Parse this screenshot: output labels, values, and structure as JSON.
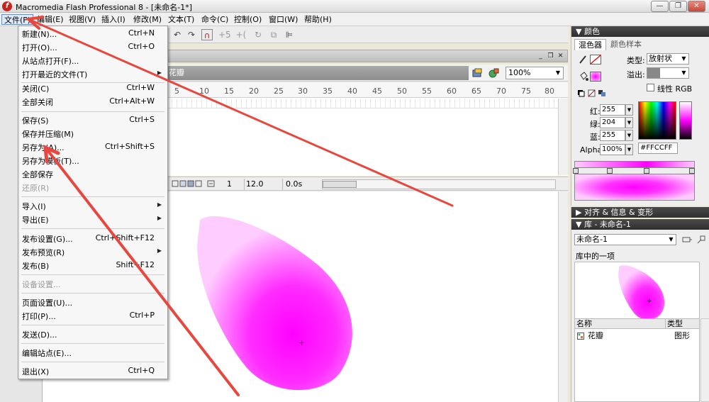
{
  "window": {
    "title": "Macromedia Flash Professional 8 - [未命名-1*]",
    "app_icon_glyph": "f",
    "minimize_glyph": "—",
    "restore_glyph": "❐",
    "close_glyph": "✕"
  },
  "menubar": {
    "items": [
      "文件(F)",
      "编辑(E)",
      "视图(V)",
      "插入(I)",
      "修改(M)",
      "文本(T)",
      "命令(C)",
      "控制(O)",
      "窗口(W)",
      "帮助(H)"
    ]
  },
  "file_menu": {
    "items": [
      {
        "label": "新建(N)...",
        "shortcut": "Ctrl+N"
      },
      {
        "label": "打开(O)...",
        "shortcut": "Ctrl+O"
      },
      {
        "label": "从站点打开(F)...",
        "shortcut": ""
      },
      {
        "label": "打开最近的文件(T)",
        "shortcut": "",
        "submenu": true
      },
      {
        "label": "关闭(C)",
        "shortcut": "Ctrl+W"
      },
      {
        "label": "全部关闭",
        "shortcut": "Ctrl+Alt+W"
      },
      {
        "label": "保存(S)",
        "shortcut": "Ctrl+S"
      },
      {
        "label": "保存并压缩(M)",
        "shortcut": ""
      },
      {
        "label": "另存为(A)...",
        "shortcut": "Ctrl+Shift+S"
      },
      {
        "label": "另存为模板(T)...",
        "shortcut": ""
      },
      {
        "label": "全部保存",
        "shortcut": ""
      },
      {
        "label": "还原(R)",
        "shortcut": "",
        "disabled": true
      },
      {
        "label": "导入(I)",
        "shortcut": "",
        "submenu": true
      },
      {
        "label": "导出(E)",
        "shortcut": "",
        "submenu": true
      },
      {
        "label": "发布设置(G)...",
        "shortcut": "Ctrl+Shift+F12"
      },
      {
        "label": "发布预览(R)",
        "shortcut": "",
        "submenu": true
      },
      {
        "label": "发布(B)",
        "shortcut": "Shift+F12"
      },
      {
        "label": "设备设置...",
        "shortcut": "",
        "disabled": true
      },
      {
        "label": "页面设置(U)...",
        "shortcut": ""
      },
      {
        "label": "打印(P)...",
        "shortcut": "Ctrl+P"
      },
      {
        "label": "发送(D)...",
        "shortcut": ""
      },
      {
        "label": "编辑站点(E)...",
        "shortcut": ""
      },
      {
        "label": "退出(X)",
        "shortcut": "Ctrl+Q"
      }
    ],
    "submenu_glyph": "▶"
  },
  "toolbar": {
    "undo_glyph": "↶",
    "redo_glyph": "↷",
    "snap_glyph": "∩",
    "smooth_glyph": "+5",
    "straighten_glyph": "+(",
    "rotate_glyph": "↻",
    "scale_glyph": "⧉",
    "align_glyph": "⊫"
  },
  "document": {
    "minimize_glyph": "_",
    "restore_glyph": "❐",
    "close_glyph": "✕",
    "scene_name": "花瓣",
    "zoom": "100%",
    "zoom_dd_glyph": "▼"
  },
  "timeline": {
    "ruler_labels": [
      "5",
      "10",
      "15",
      "20",
      "25",
      "30",
      "35",
      "40",
      "45",
      "50",
      "55",
      "60",
      "65",
      "70",
      "75",
      "80"
    ],
    "current_frame": "1",
    "frame_rate": "12.0 fps",
    "elapsed": "0.0s"
  },
  "stage": {
    "fill_center": "#FF00FF",
    "fill_edge": "#FFCCFF",
    "registration_glyph": "+"
  },
  "color_panel": {
    "title": "颜色",
    "tabs": [
      "混色器",
      "颜色样本"
    ],
    "type_label": "类型:",
    "type_value": "放射状",
    "overflow_label": "溢出:",
    "linear_rgb_label": "线性 RGB",
    "red_label": "红:",
    "red_value": "255",
    "green_label": "绿:",
    "green_value": "204",
    "blue_label": "蓝:",
    "blue_value": "255",
    "alpha_label": "Alpha:",
    "alpha_value": "100%",
    "hex_value": "#FFCCFF",
    "dd_glyph": "▼"
  },
  "align_panel": {
    "title": "对齐 & 信息 & 变形"
  },
  "library_panel": {
    "title": "库 - 未命名-1",
    "document_select": "未命名-1",
    "item_count": "库中的一项",
    "col_name": "名称",
    "col_type": "类型",
    "items": [
      {
        "name": "花瓣",
        "type": "图形"
      }
    ],
    "dd_glyph": "▼"
  },
  "annotation_color": "#E8473F"
}
